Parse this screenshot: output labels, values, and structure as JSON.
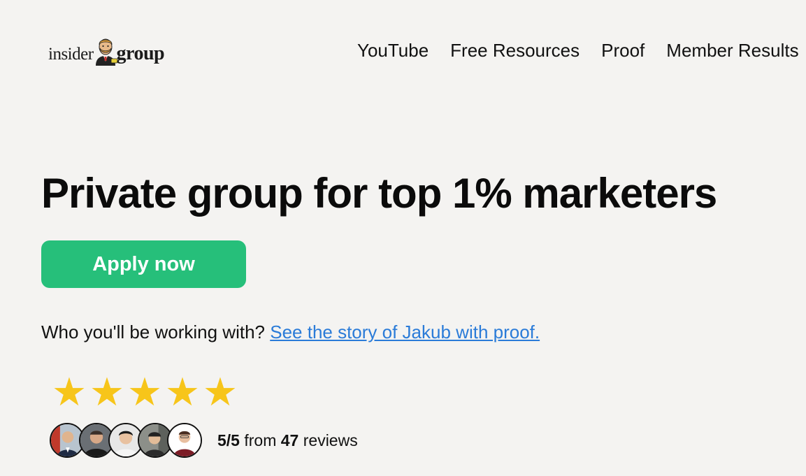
{
  "brand": {
    "logo_word1": "insider",
    "logo_word2": "group"
  },
  "nav": {
    "items": [
      "YouTube",
      "Free Resources",
      "Proof",
      "Member Results"
    ]
  },
  "hero": {
    "headline": "Private group for top 1% marketers",
    "apply_label": "Apply now",
    "story_prefix": "Who you'll be working with? ",
    "story_link": "See the story of Jakub with proof."
  },
  "reviews": {
    "stars": [
      "★",
      "★",
      "★",
      "★",
      "★"
    ],
    "star_color": "#f7c51a",
    "score": "5/5",
    "from_text": "from",
    "count": "47",
    "reviews_text": "reviews"
  },
  "colors": {
    "background": "#f4f3f1",
    "cta": "#26bf7a",
    "link": "#2a7bd8"
  }
}
